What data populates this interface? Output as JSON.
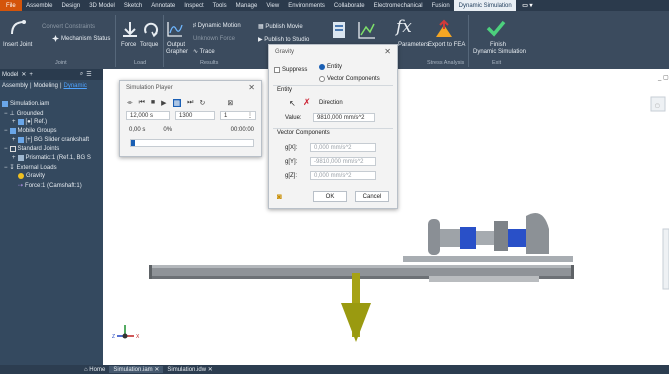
{
  "menubar": {
    "file": "File",
    "items": [
      "Assemble",
      "Design",
      "3D Model",
      "Sketch",
      "Annotate",
      "Inspect",
      "Tools",
      "Manage",
      "View",
      "Environments",
      "Collaborate",
      "Electromechanical",
      "Fusion"
    ],
    "active": "Dynamic Simulation",
    "extra": "▭ ▾"
  },
  "ribbon": {
    "insert_joint": "Insert Joint",
    "convert_constraints": "Convert Constraints",
    "mechanism_status": "Mechanism Status",
    "force": "Force",
    "torque": "Torque",
    "output": "Output",
    "grapher": "Grapher",
    "dynamic_motion": "Dynamic Motion",
    "unknown_force": "Unknown Force",
    "trace": "Trace",
    "publish_movie": "Publish Movie",
    "publish_studio": "Publish to Studio",
    "parameters": "Parameters",
    "export_fea": "Export to FEA",
    "finish": "Finish",
    "finish_sub": "Dynamic Simulation",
    "groups": {
      "joint": "Joint",
      "load": "Load",
      "results": "Results",
      "stress": "Stress Analysis",
      "exit": "Exit"
    }
  },
  "browser": {
    "header": "Model",
    "tabs": [
      "Assembly",
      "Modeling",
      "Dynamic"
    ],
    "items": [
      {
        "label": "Simulation.iam",
        "indent": 0
      },
      {
        "label": "Grounded",
        "indent": 1
      },
      {
        "label": "[●] Ref.)",
        "indent": 2
      },
      {
        "label": "Mobile Groups",
        "indent": 1
      },
      {
        "label": "[+] BG Slider crankshaft",
        "indent": 2
      },
      {
        "label": "Standard Joints",
        "indent": 1
      },
      {
        "label": "Prismatic:1 (Ref.1, BG S",
        "indent": 2
      },
      {
        "label": "External Loads",
        "indent": 1
      },
      {
        "label": "Gravity",
        "indent": 2
      },
      {
        "label": "Force:1 (Camshaft:1)",
        "indent": 2
      }
    ]
  },
  "sim_player": {
    "title": "Simulation Player",
    "end_time": "12,000 s",
    "images": "1300",
    "filter": "1",
    "current_time": "0,00 s",
    "percent": "0%",
    "clock": "00:00:00",
    "progress": 0
  },
  "gravity": {
    "title": "Gravity",
    "suppress": "Suppress",
    "entity_radio": "Entity",
    "vector_radio": "Vector Components",
    "entity_section": "Entity",
    "direction": "Direction",
    "value_label": "Value:",
    "value": "9810,000 mm/s^2",
    "vector_section": "Vector Components",
    "gx_label": "g[X]:",
    "gx": "0,000 mm/s^2",
    "gy_label": "g[Y]:",
    "gy": "-9810,000 mm/s^2",
    "gz_label": "g[Z]:",
    "gz": "0,000 mm/s^2",
    "ok": "OK",
    "cancel": "Cancel"
  },
  "tabs": {
    "home": "Home",
    "doc1": "Simulation.iam",
    "doc2": "Simulation.idw"
  },
  "colors": {
    "accent": "#1a5fb4",
    "force_arrow": "#9a9a10",
    "file": "#d4540a"
  }
}
